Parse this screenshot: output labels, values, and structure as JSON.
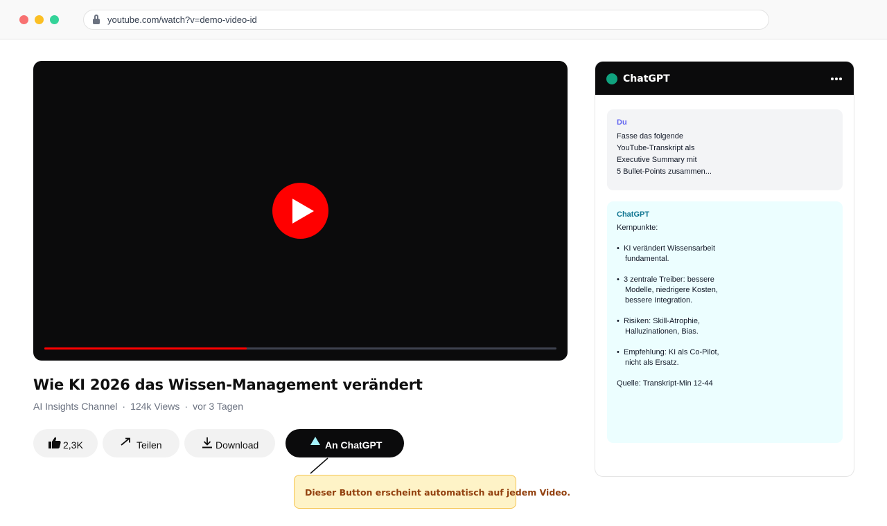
{
  "browser": {
    "url": "youtube.com/watch?v=demo-video-id"
  },
  "video": {
    "title": "Wie KI 2026 das Wissen-Management verändert",
    "channel": "AI Insights Channel",
    "views": "124k Views",
    "age": "vor 3 Tagen",
    "meta_separator": "·",
    "progress": 0.395
  },
  "actions": {
    "like_count": "2,3K",
    "share_label": "Teilen",
    "download_label": "Download",
    "chatgpt_label": "An ChatGPT"
  },
  "tooltip": {
    "text": "Dieser Button erscheint automatisch auf jedem Video."
  },
  "chat": {
    "title": "ChatGPT",
    "user_message": {
      "author": "Du",
      "lines": [
        "Fasse das folgende",
        "YouTube-Transkript als",
        "Executive Summary mit",
        "5 Bullet-Points zusammen..."
      ]
    },
    "bot_message": {
      "author": "ChatGPT",
      "heading": "Kernpunkte:",
      "bullet_char": "•",
      "bullets": [
        [
          "KI verändert Wissensarbeit",
          "fundamental."
        ],
        [
          "3 zentrale Treiber: bessere",
          "Modelle, niedrigere Kosten,",
          "bessere Integration."
        ],
        [
          "Risiken: Skill-Atrophie,",
          "Halluzinationen, Bias."
        ],
        [
          "Empfehlung: KI als Co-Pilot,",
          "nicht als Ersatz."
        ]
      ],
      "source": "Quelle: Transkript-Min 12-44"
    }
  },
  "colors": {
    "accent_red": "#ff0000",
    "brand_green": "#10a37f",
    "user_author": "#6366f1",
    "bot_author": "#0e7490",
    "tooltip_bg": "#fef3c7",
    "tooltip_text": "#92400e"
  },
  "icons": {
    "like": "thumbs-up-icon",
    "share": "share-arrow-icon",
    "download": "download-icon",
    "chatgpt": "triangle-logo-icon",
    "lock": "lock-icon",
    "more": "more-horizontal-icon",
    "play": "play-icon"
  }
}
